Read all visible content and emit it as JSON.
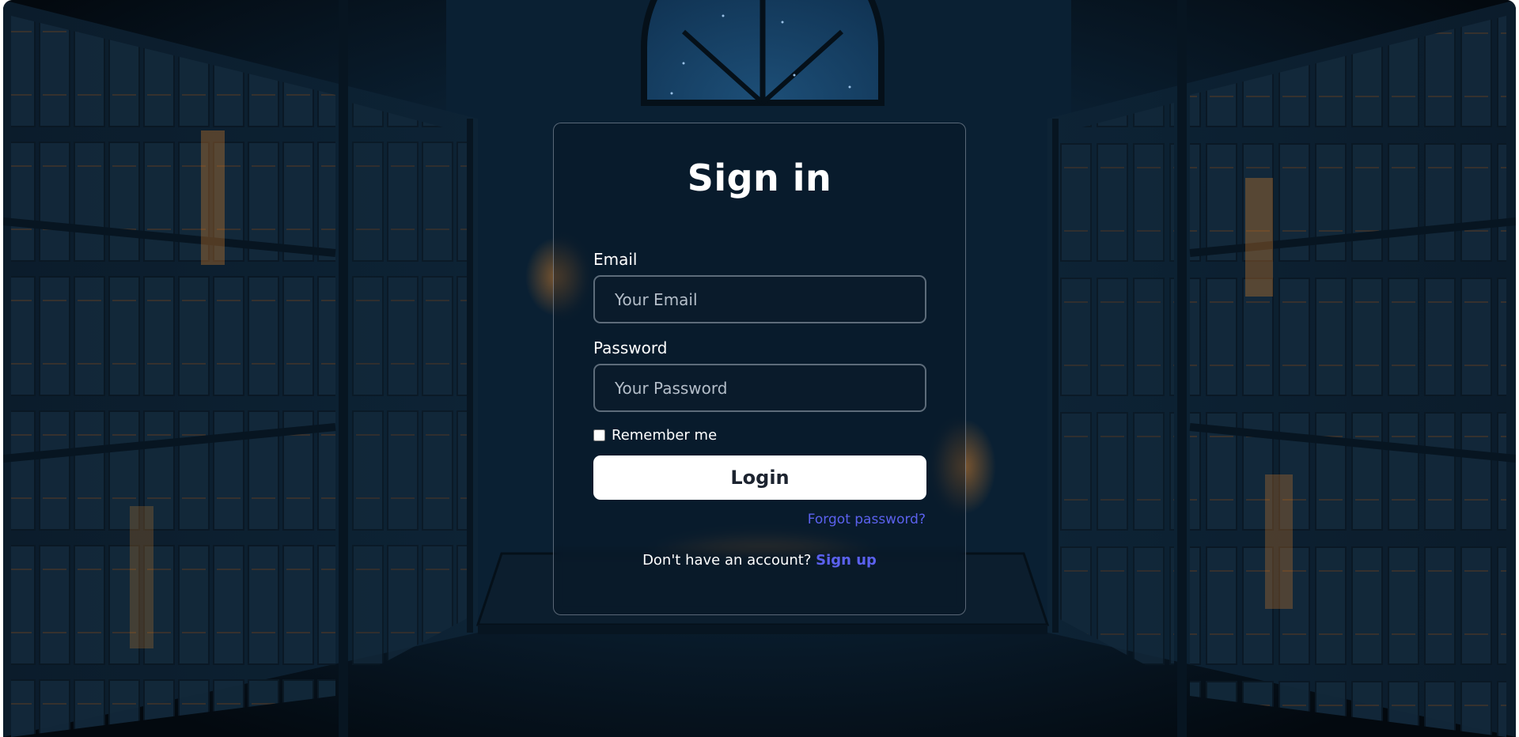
{
  "login": {
    "title": "Sign in",
    "email_label": "Email",
    "email_placeholder": "Your Email",
    "email_value": "",
    "password_label": "Password",
    "password_placeholder": "Your Password",
    "password_value": "",
    "remember_label": "Remember me",
    "remember_checked": false,
    "login_button": "Login",
    "forgot_password": "Forgot password?",
    "signup_prompt": "Don't have an account?",
    "signup_link": "Sign up"
  },
  "colors": {
    "background": "#061522",
    "card_border": "#bec8d4",
    "link": "#5b61ee",
    "button_bg": "#ffffff",
    "button_text": "#1d2430",
    "book_glow": "#d9822b"
  }
}
